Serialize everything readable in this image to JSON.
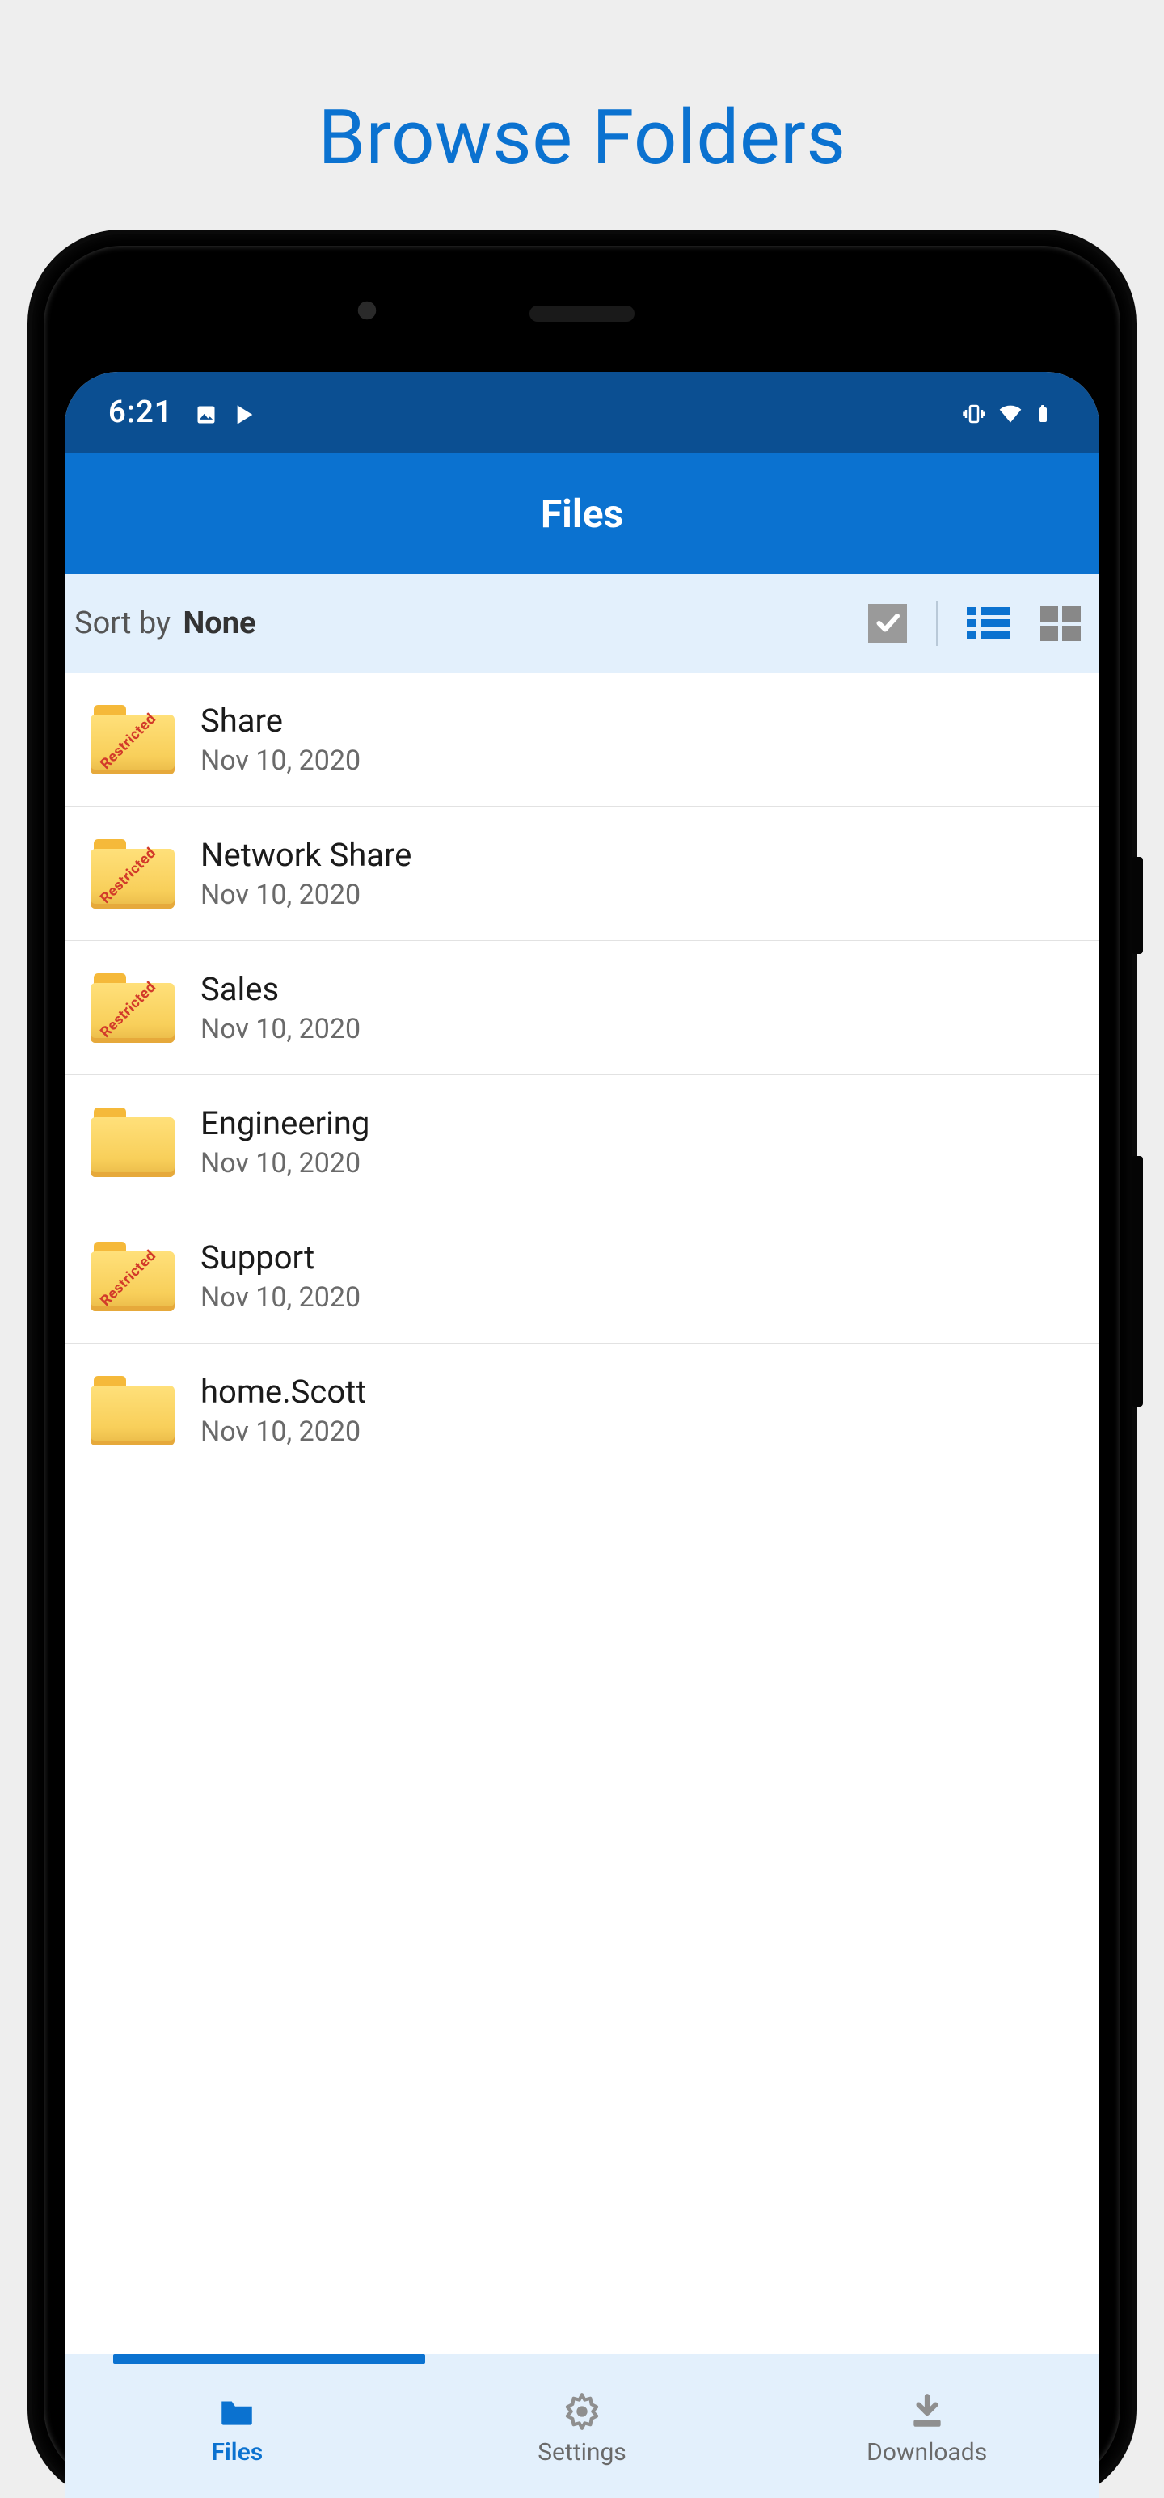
{
  "promo": {
    "title": "Browse Folders"
  },
  "statusbar": {
    "time": "6:21"
  },
  "appbar": {
    "title": "Files"
  },
  "sortbar": {
    "label": "Sort by ",
    "value": "None"
  },
  "folders": [
    {
      "name": "Share",
      "date": "Nov 10, 2020",
      "restricted": true
    },
    {
      "name": "Network Share",
      "date": "Nov 10, 2020",
      "restricted": true
    },
    {
      "name": "Sales",
      "date": "Nov 10, 2020",
      "restricted": true
    },
    {
      "name": "Engineering",
      "date": "Nov 10, 2020",
      "restricted": false
    },
    {
      "name": "Support",
      "date": "Nov 10, 2020",
      "restricted": true
    },
    {
      "name": "home.Scott",
      "date": "Nov 10, 2020",
      "restricted": false
    }
  ],
  "tabs": {
    "files": {
      "label": "Files",
      "active": true
    },
    "settings": {
      "label": "Settings",
      "active": false
    },
    "downloads": {
      "label": "Downloads",
      "active": false
    }
  },
  "icons": {
    "restricted_label": "Restricted"
  },
  "colors": {
    "accent": "#0b72d0",
    "statusbar": "#0b4f92",
    "panel": "#e3f0fc"
  }
}
